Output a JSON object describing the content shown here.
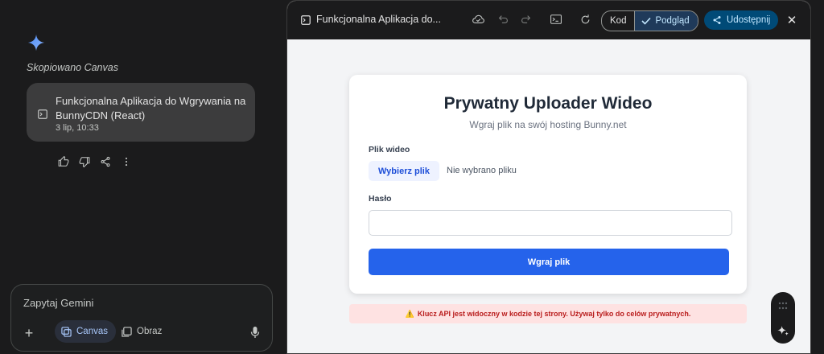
{
  "sidebar": {
    "copied_label": "Skopiowano Canvas",
    "canvas_card": {
      "title": "Funkcjonalna Aplikacja do Wgrywania na BunnyCDN (React)",
      "date": "3 lip, 10:33"
    },
    "feedback_icons": [
      "thumb-up-icon",
      "thumb-down-icon",
      "share-icon",
      "more-vert-icon"
    ]
  },
  "prompt": {
    "placeholder": "Zapytaj Gemini",
    "canvas_label": "Canvas",
    "image_label": "Obraz"
  },
  "toolbar": {
    "title": "Funkcjonalna Aplikacja do...",
    "code_label": "Kod",
    "preview_label": "Podgląd",
    "share_label": "Udostępnij"
  },
  "preview": {
    "heading": "Prywatny Uploader Wideo",
    "subheading": "Wgraj plik na swój hosting Bunny.net",
    "video_label": "Plik wideo",
    "choose_file": "Wybierz plik",
    "no_file": "Nie wybrano pliku",
    "password_label": "Hasło",
    "password_value": "",
    "upload_button": "Wgraj plik",
    "warning": "Klucz API jest widoczny w kodzie tej strony. Używaj tylko do celów prywatnych.",
    "warning_glyph": "⚠️"
  },
  "colors": {
    "accent_blue": "#2563eb",
    "share_bg": "#004a77",
    "warning_bg": "#fee2e2",
    "warning_text": "#b91c1c"
  }
}
